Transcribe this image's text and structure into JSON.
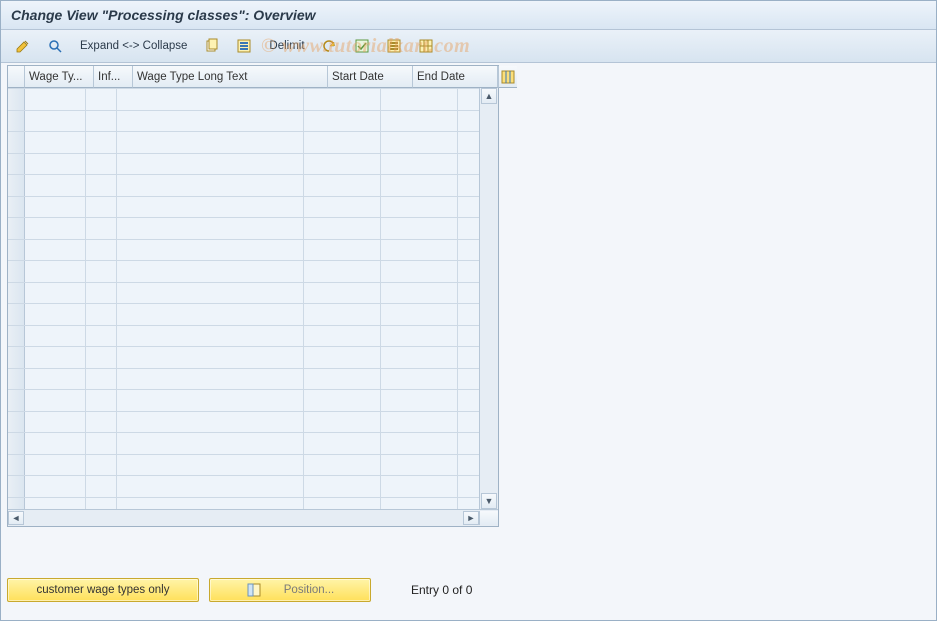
{
  "title": "Change View \"Processing classes\": Overview",
  "toolbar": {
    "expand_collapse_label": "Expand <-> Collapse",
    "delimit_label": "Delimit"
  },
  "table": {
    "columns": {
      "wage_type": "Wage Ty...",
      "inf": "Inf...",
      "long_text": "Wage Type Long Text",
      "start_date": "Start Date",
      "end_date": "End Date"
    },
    "row_count": 20
  },
  "footer": {
    "customer_btn": "customer wage types only",
    "position_btn": "Position...",
    "entry_status": "Entry 0 of 0"
  },
  "watermark": "© www.tutorialkart.com"
}
